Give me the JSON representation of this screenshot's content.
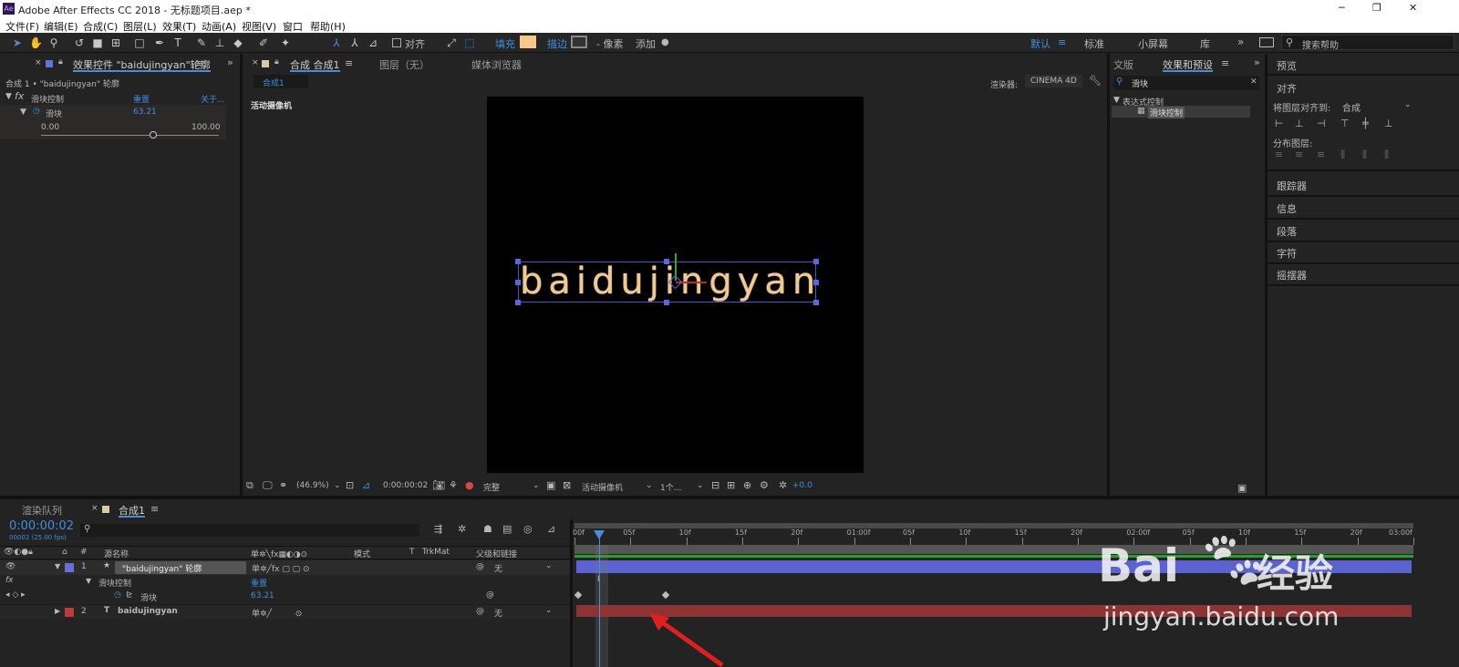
{
  "app": {
    "title": "Adobe After Effects CC 2018 - 无标题项目.aep *",
    "logo": "Ae"
  },
  "window": {
    "minimize": "─",
    "restore": "❐",
    "close": "✕"
  },
  "menu": [
    "文件(F)",
    "编辑(E)",
    "合成(C)",
    "图层(L)",
    "效果(T)",
    "动画(A)",
    "视图(V)",
    "窗口",
    "帮助(H)"
  ],
  "toolbar": {
    "align": "对齐",
    "fill": "填充",
    "stroke": "描边",
    "pixels": "- 像素",
    "add": "添加",
    "workspaces": [
      "默认",
      "标准",
      "小屏幕",
      "库"
    ],
    "search_placeholder": "搜索帮助",
    "fill_color": "#f4c98a"
  },
  "effect_controls": {
    "tab": "效果控件 \"baidujingyan\"轮廓",
    "breadcrumb": "合成 1 • \"baidujingyan\" 轮廓",
    "effect_name": "滑块控制",
    "reset": "重置",
    "about": "关于...",
    "param": "滑块",
    "value": "63.21",
    "min": "0.00",
    "max": "100.00",
    "slider_value": 0.6321
  },
  "comp_viewer": {
    "tab": "合成 合成1",
    "layer_tab": "图层（无）",
    "media_tab": "媒体浏览器",
    "subtab": "合成1",
    "renderer_label": "渲染器:",
    "renderer": "CINEMA 4D",
    "camera_label": "活动摄像机",
    "text": "baidujingyan",
    "zoom": "(46.9%)",
    "timecode": "0:00:00:02",
    "quality": "完整",
    "camera": "活动摄像机",
    "views": "1个...",
    "exposure": "+0.0"
  },
  "effects_presets": {
    "tabs": [
      "文版",
      "效果和预设"
    ],
    "search": "滑块",
    "category": "表达式控制",
    "item": "滑块控制"
  },
  "right_panels": {
    "preview": "预览",
    "align": "对齐",
    "align_to_label": "将图层对齐到:",
    "align_to": "合成",
    "distribute": "分布图层:",
    "items": [
      "跟踪器",
      "信息",
      "段落",
      "字符",
      "摇摆器"
    ]
  },
  "timeline": {
    "tabs": [
      "渲染队列",
      "合成1"
    ],
    "timecode": "0:00:00:02",
    "frame_info": "00002 (25.00 fps)",
    "columns": {
      "num": "#",
      "source": "源名称",
      "mode": "模式",
      "t": "T",
      "trkmat": "TrkMat",
      "parent": "父级和链接"
    },
    "layers": [
      {
        "num": "1",
        "name": "\"baidujingyan\" 轮廓",
        "parent": "无",
        "color": "#6670d6"
      },
      {
        "num": "2",
        "name": "baidujingyan",
        "parent": "无",
        "color": "#c0393b"
      }
    ],
    "effect_row": "滑块控制",
    "reset": "重置",
    "param": "滑块",
    "param_value": "63.21",
    "ruler": [
      "00f",
      "05f",
      "10f",
      "15f",
      "20f",
      "01:00f",
      "05f",
      "10f",
      "15f",
      "20f",
      "02:00f",
      "05f",
      "10f",
      "15f",
      "20f",
      "03:00f"
    ]
  },
  "watermark": {
    "brand": "Bai",
    "brand2": "经验",
    "url": "jingyan.baidu.com"
  }
}
